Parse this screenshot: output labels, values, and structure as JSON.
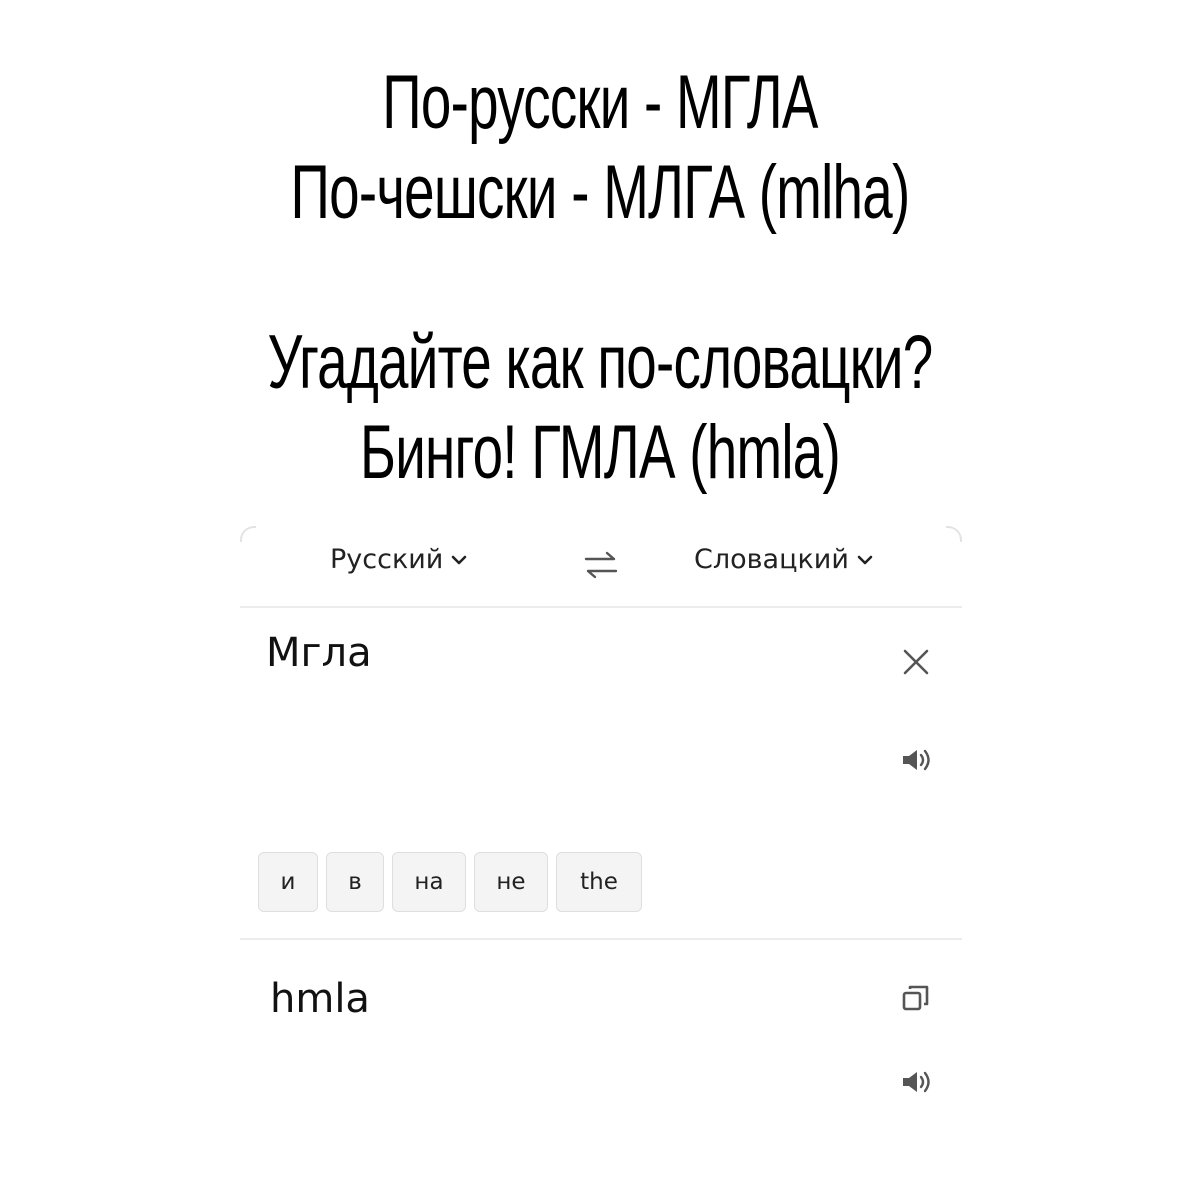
{
  "caption": {
    "line1": "По-русски - МГЛА",
    "line2": "По-чешски - МЛГА (mlha)",
    "line3": "Угадайте как по-словацки?",
    "line4": "Бинго! ГМЛА (hmla)"
  },
  "translator": {
    "source_lang": "Русский",
    "target_lang": "Словацкий",
    "source_text": "Мгла",
    "target_text": "hmla",
    "suggestions": [
      "и",
      "в",
      "на",
      "не",
      "the"
    ]
  },
  "icons": {
    "swap": "swap-arrows-icon",
    "clear": "close-icon",
    "speak": "speaker-icon",
    "copy": "copy-icon",
    "chevron": "chevron-down-icon"
  },
  "colors": {
    "icon_gray": "#555555",
    "divider": "#ececec",
    "chip_bg": "#f4f4f4"
  }
}
